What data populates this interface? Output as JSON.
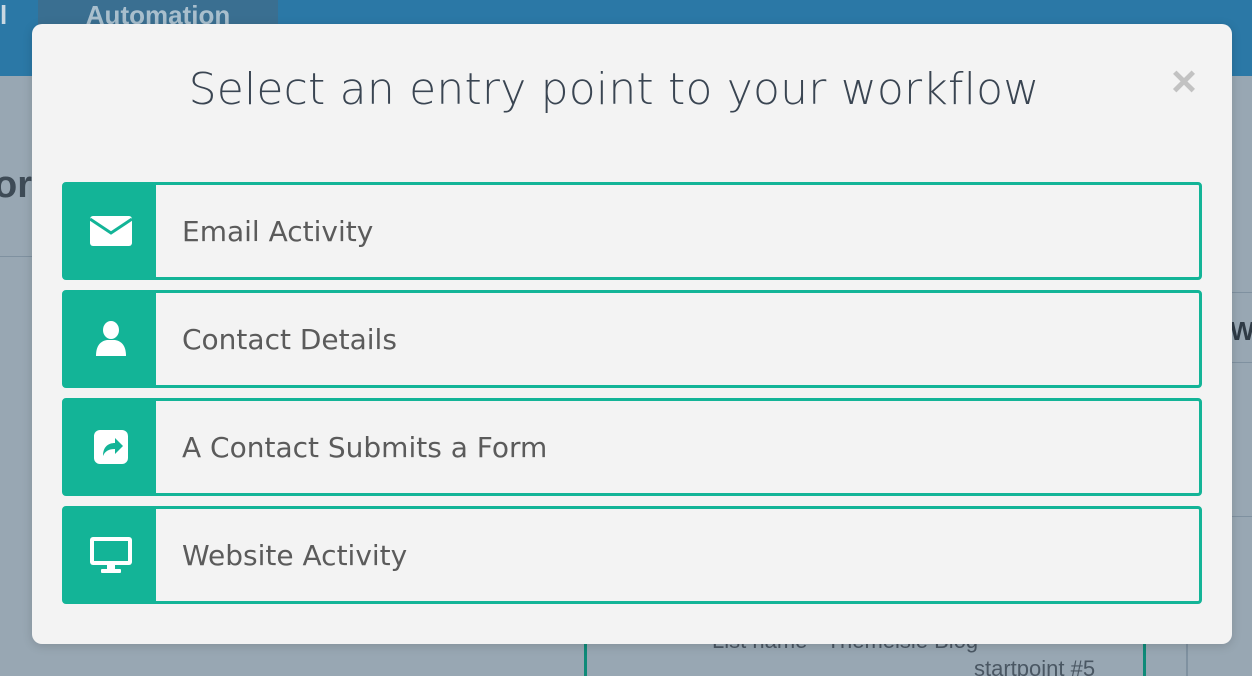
{
  "background": {
    "top_tab_label": "Automation",
    "left_tab_fragment": "l",
    "heading_fragment": "or",
    "right_text_fragment": "W",
    "card_line1": "List name - Themeisle Blog",
    "card_line2": "startpoint #5"
  },
  "modal": {
    "title": "Select an entry point to your workflow",
    "close_label": "×",
    "options": [
      {
        "label": "Email Activity",
        "icon": "envelope-icon"
      },
      {
        "label": "Contact Details",
        "icon": "user-icon"
      },
      {
        "label": "A Contact Submits a Form",
        "icon": "share-square-icon"
      },
      {
        "label": "Website Activity",
        "icon": "desktop-icon"
      }
    ]
  },
  "colors": {
    "accent": "#13b497",
    "topbar": "#2b78a6",
    "overlay": "#98a7b3",
    "modal_bg": "#f3f3f3",
    "title_text": "#3a4552",
    "option_text": "#5b5b5b"
  }
}
